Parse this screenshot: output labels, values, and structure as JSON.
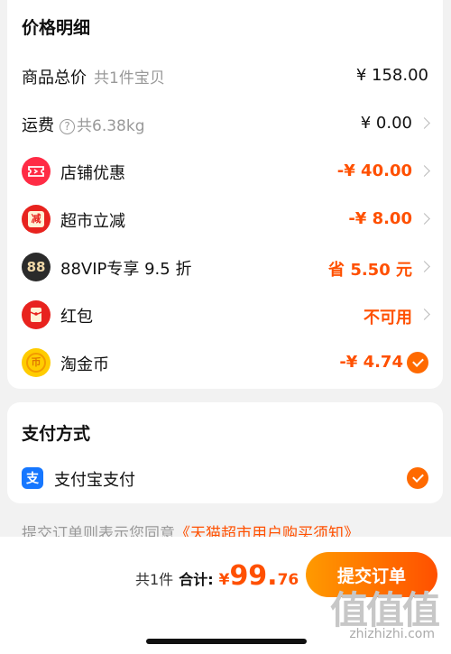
{
  "price_section": {
    "title": "价格明细",
    "total": {
      "label": "商品总价",
      "sub": "共1件宝贝",
      "value": "¥ 158.00"
    },
    "shipping": {
      "label": "运费",
      "sub": "共6.38kg",
      "value": "¥ 0.00"
    },
    "discounts": [
      {
        "label": "店铺优惠",
        "value": "-¥ 40.00",
        "icon": "coupon-icon",
        "color": "#ff2b45"
      },
      {
        "label": "超市立减",
        "value": "-¥ 8.00",
        "icon": "supermarket-discount-icon",
        "color": "#e8231e"
      },
      {
        "label": "88VIP专享 9.5 折",
        "value": "省 5.50 元",
        "icon": "88vip-icon",
        "color": "#2b2b2b"
      },
      {
        "label": "红包",
        "value": "不可用",
        "icon": "red-envelope-icon",
        "color": "#e8231e"
      },
      {
        "label": "淘金币",
        "value": "-¥ 4.74",
        "icon": "gold-coin-icon",
        "color": "#ffcc00"
      }
    ],
    "icon_glyphs": {
      "supermarket": "减",
      "vip": "88",
      "coin": "币"
    }
  },
  "payment_section": {
    "title": "支付方式",
    "method": {
      "label": "支付宝支付",
      "icon": "alipay-icon",
      "icon_glyph": "支",
      "color": "#1677ff"
    }
  },
  "agreement": {
    "text": "提交订单则表示您同意",
    "link": "《天猫超市用户购买须知》"
  },
  "footer": {
    "count": "共1件",
    "total_label": "合计:",
    "currency": "¥",
    "amount_int": "99.",
    "amount_dec": "76",
    "submit_label": "提交订单"
  },
  "watermark": {
    "logo": "值值值",
    "url": "zhizhizhi.com"
  },
  "colors": {
    "accent": "#ff5000",
    "muted": "#999999",
    "check": "#ff6a00"
  }
}
